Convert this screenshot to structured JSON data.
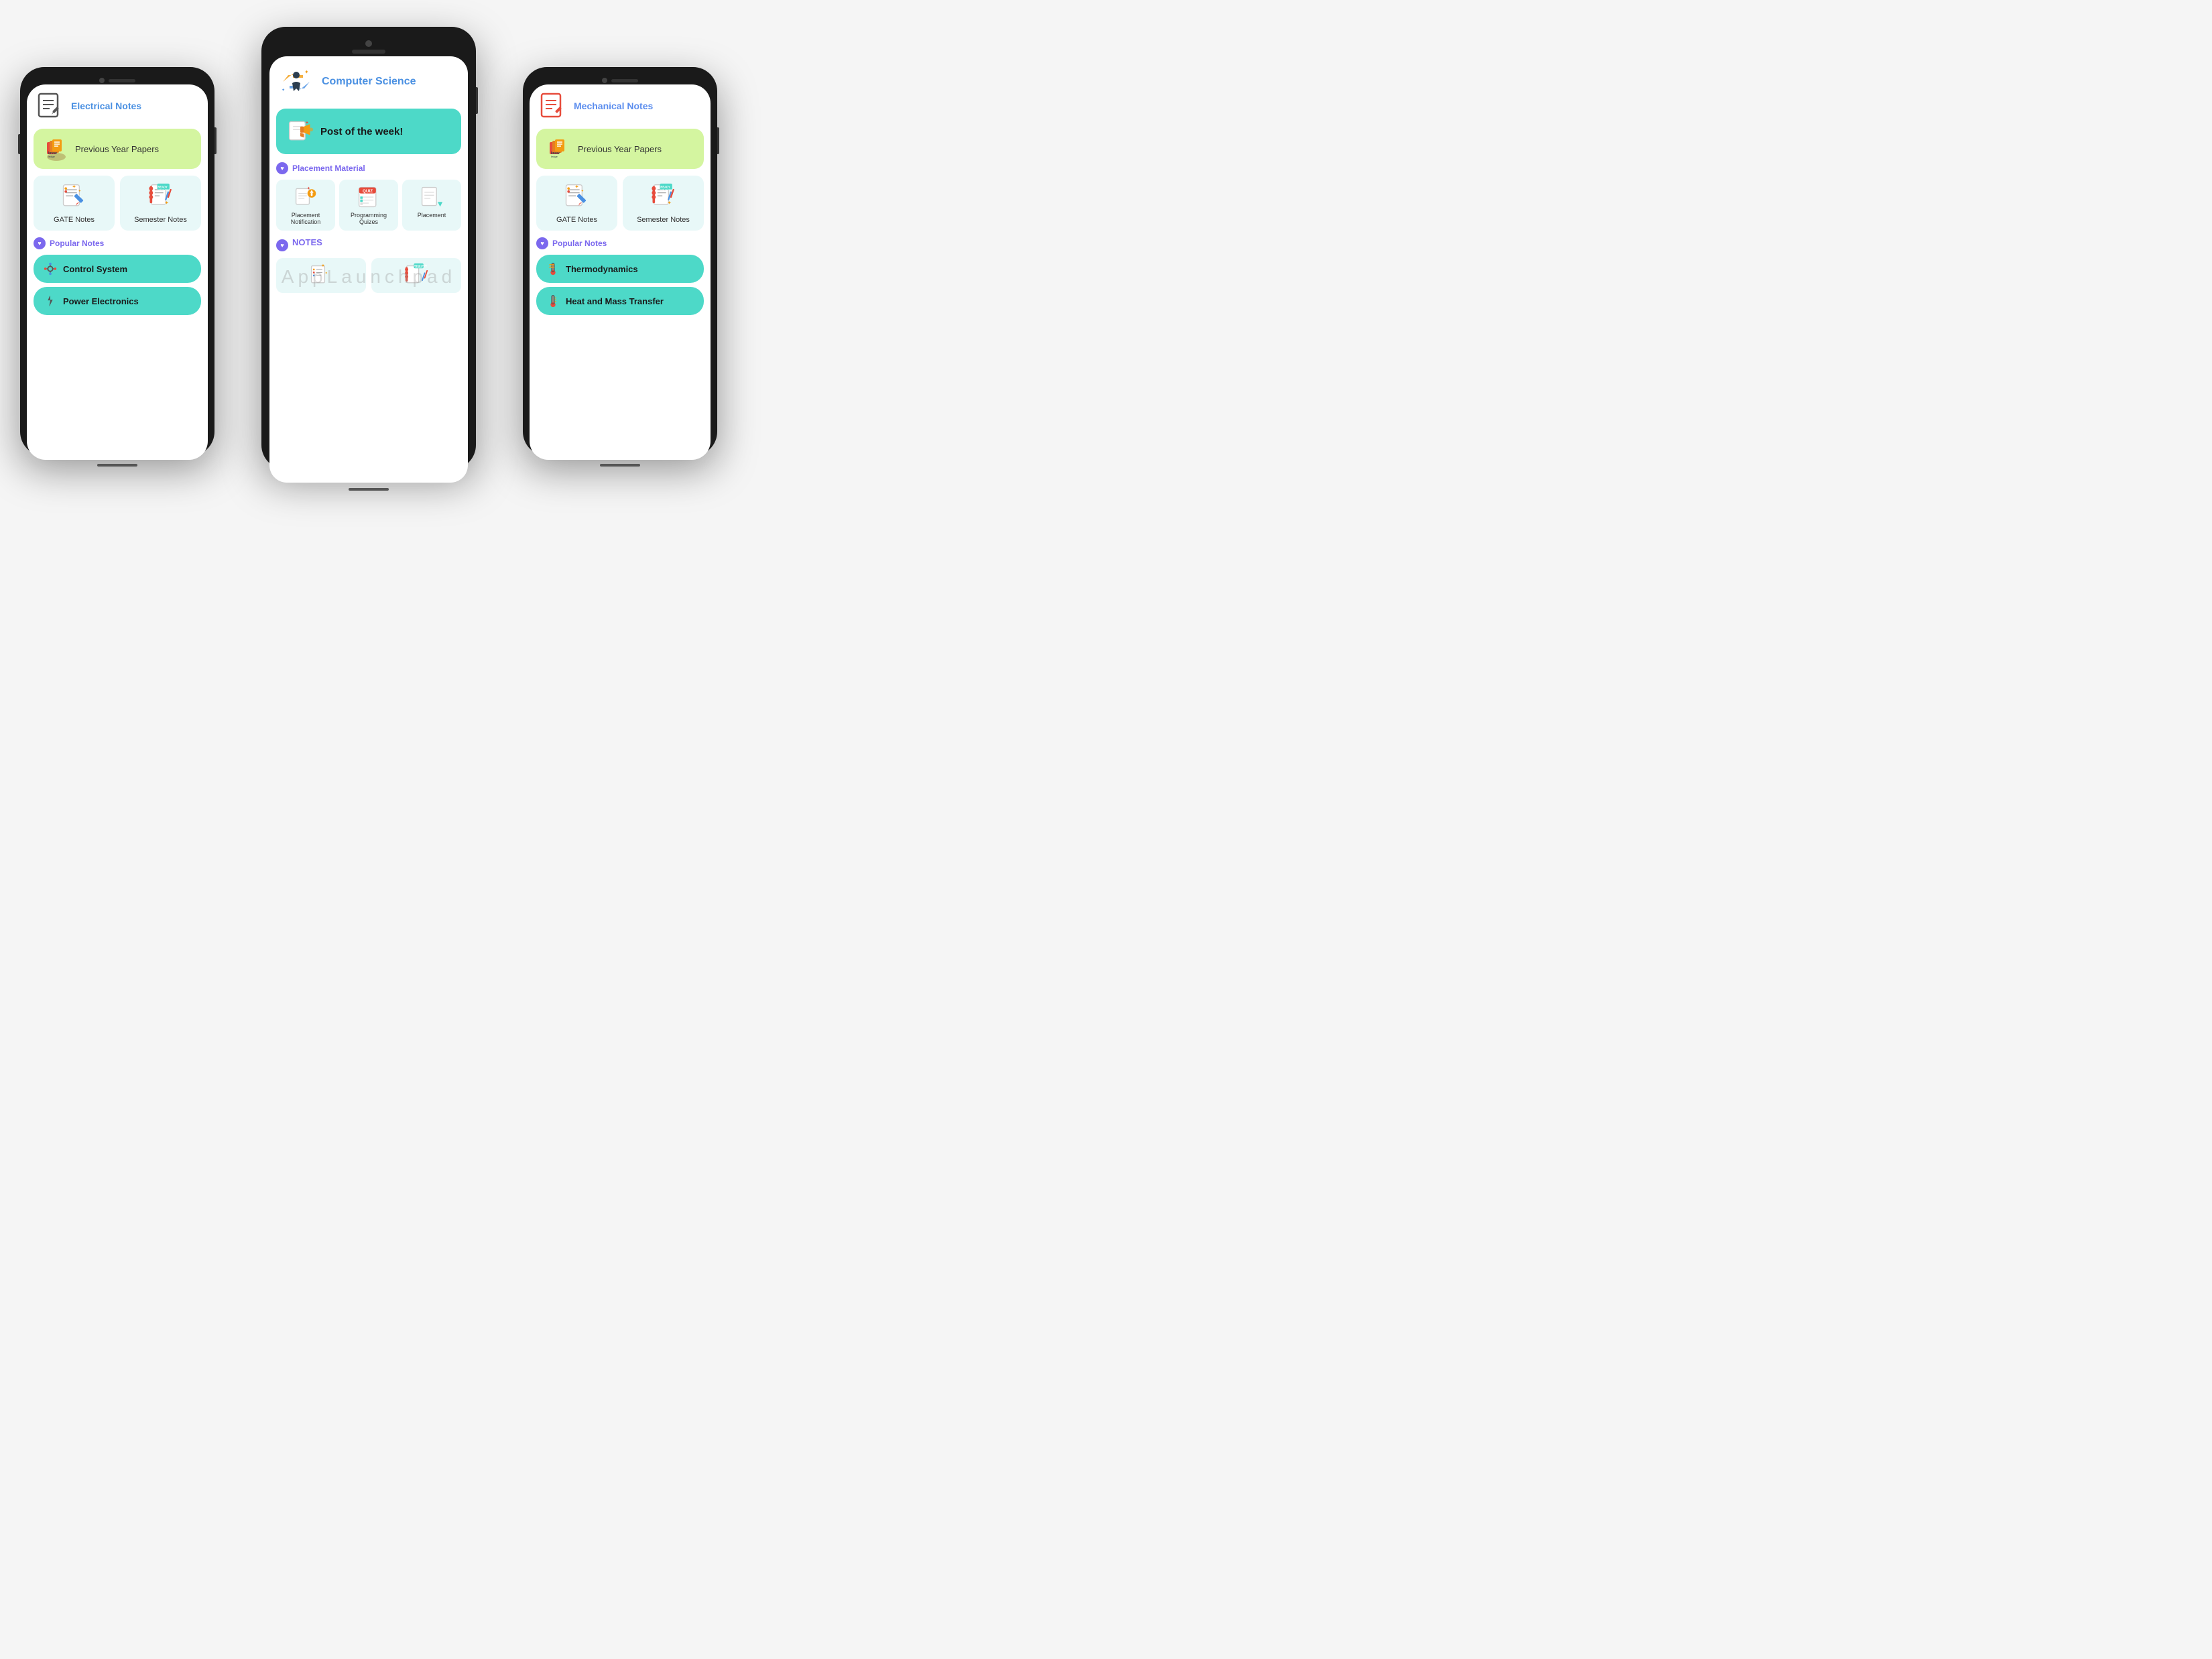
{
  "phones": {
    "left": {
      "title": "Electrical Notes",
      "prev_papers": "Previous Year Papers",
      "gate_notes": "GATE Notes",
      "semester_notes": "Semester Notes",
      "popular_notes": "Popular Notes",
      "control_system": "Control System",
      "power_electronics": "Power Electronics"
    },
    "center": {
      "title": "Computer Science",
      "post_week": "Post of the week!",
      "placement_material": "Placement Material",
      "placement_notification": "Placement Notification",
      "programming_quizes": "Programming Quizes",
      "placement_label": "Placement",
      "notes_section": "NOTES",
      "quiz_label": "QUIZ"
    },
    "right": {
      "title": "Mechanical Notes",
      "prev_papers": "Previous Year Papers",
      "gate_notes": "GATE Notes",
      "semester_notes": "Semester Notes",
      "popular_notes": "Popular Notes",
      "thermodynamics": "Thermodynamics",
      "heat_mass": "Heat and Mass Transfer"
    }
  },
  "watermark": "AppLaunchpad"
}
